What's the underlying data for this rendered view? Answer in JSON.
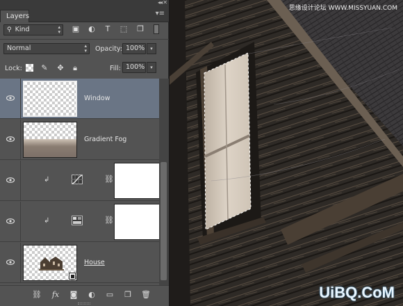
{
  "panel": {
    "tab_label": "Layers",
    "filter": {
      "kind_label": "Kind"
    },
    "blend": {
      "mode": "Normal",
      "opacity_label": "Opacity:",
      "opacity": "100%"
    },
    "lock": {
      "label": "Lock:",
      "fill_label": "Fill:",
      "fill": "100%"
    },
    "layers": [
      {
        "name": "Window",
        "selected": true
      },
      {
        "name": "Gradient Fog",
        "selected": false
      },
      {
        "name": "",
        "type": "adjustment-curves",
        "clipped": true
      },
      {
        "name": "",
        "type": "adjustment-levels",
        "clipped": true
      },
      {
        "name": "House",
        "selected": false
      }
    ]
  },
  "canvas": {
    "watermark": "思缘设计论坛 WWW.MISSYUAN.COM",
    "logo": "UiBQ.CoM"
  },
  "colors": {
    "selected_row": "#6a7585",
    "panel_bg": "#535353"
  }
}
